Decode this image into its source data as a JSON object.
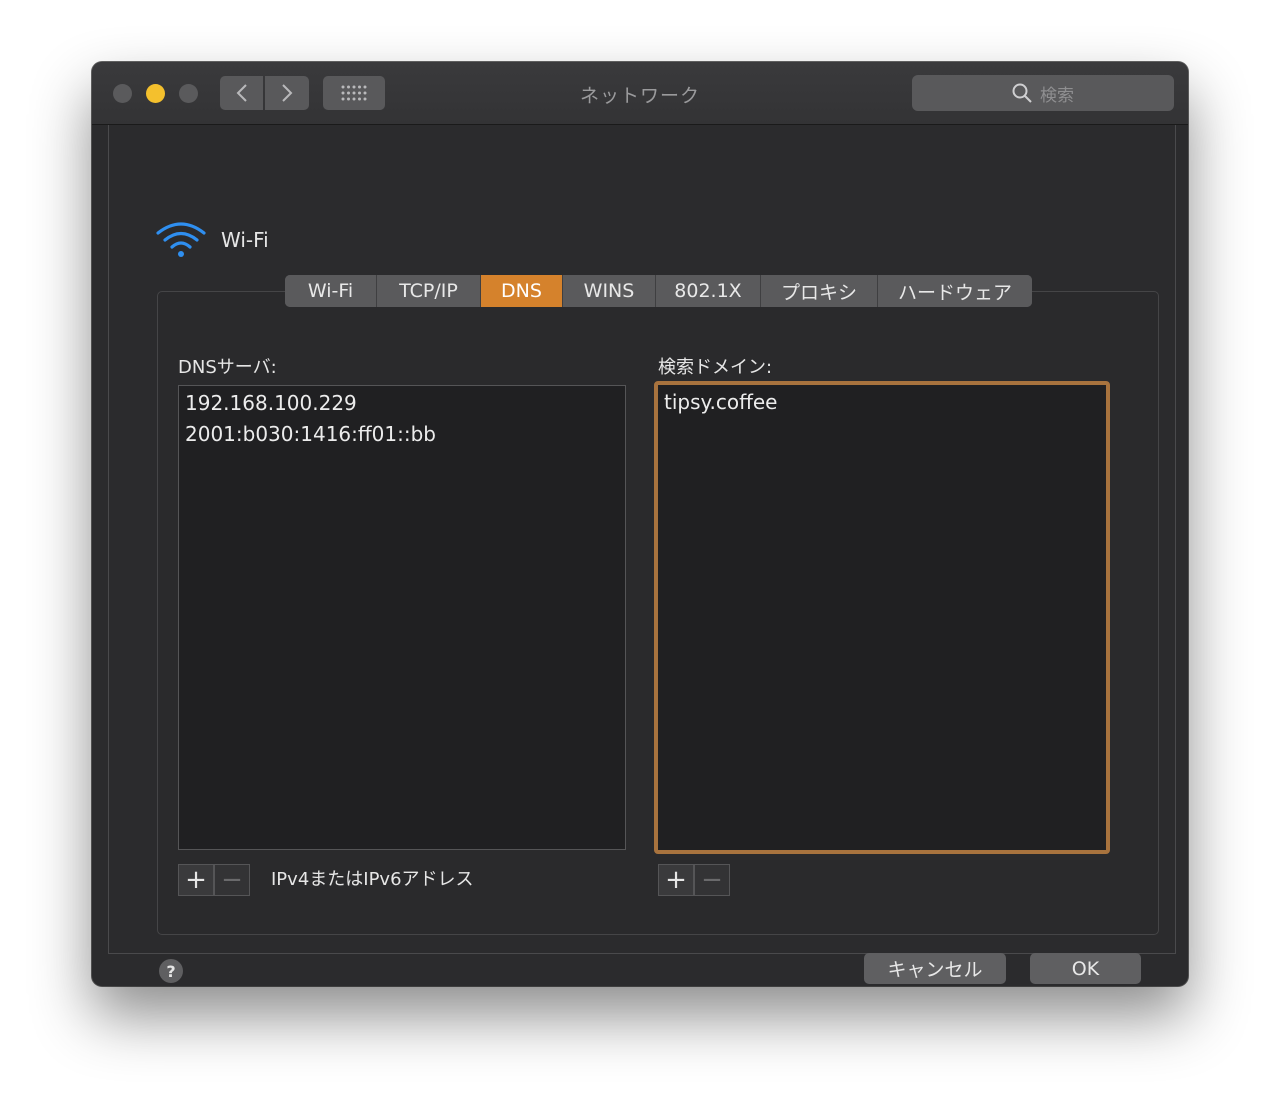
{
  "window": {
    "title": "ネットワーク",
    "search_placeholder": "検索",
    "nav_back_icon": "chevron-left-icon",
    "nav_forward_icon": "chevron-right-icon",
    "show_all_icon": "grid-icon"
  },
  "header": {
    "interface_name": "Wi-Fi",
    "icon": "wifi-icon"
  },
  "tabs": [
    {
      "label": "Wi-Fi",
      "active": false
    },
    {
      "label": "TCP/IP",
      "active": false
    },
    {
      "label": "DNS",
      "active": true
    },
    {
      "label": "WINS",
      "active": false
    },
    {
      "label": "802.1X",
      "active": false
    },
    {
      "label": "プロキシ",
      "active": false
    },
    {
      "label": "ハードウェア",
      "active": false
    }
  ],
  "dns_servers": {
    "label": "DNSサーバ:",
    "entries": [
      "192.168.100.229",
      "2001:b030:1416:ff01::bb"
    ],
    "add_label": "+",
    "remove_label": "−",
    "hint": "IPv4またはIPv6アドレス"
  },
  "search_domains": {
    "label": "検索ドメイン:",
    "entries": [
      "tipsy.coffee"
    ],
    "add_label": "+",
    "remove_label": "−"
  },
  "footer": {
    "help_label": "?",
    "cancel_label": "キャンセル",
    "ok_label": "OK"
  },
  "colors": {
    "accent_tab": "#d5822c",
    "focus_ring": "#a8733e",
    "minimize_button": "#f4c02d"
  }
}
